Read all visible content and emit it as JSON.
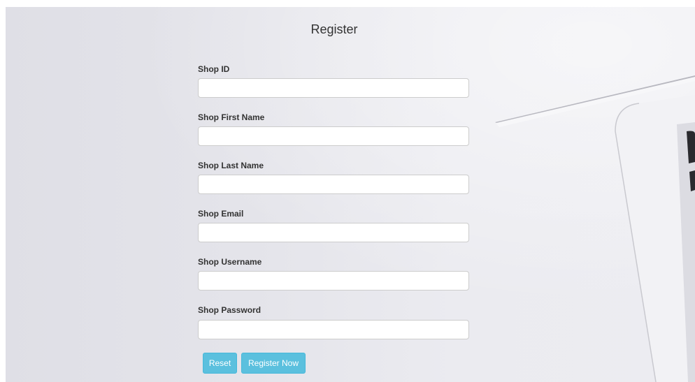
{
  "form": {
    "title": "Register",
    "fields": [
      {
        "label": "Shop ID",
        "value": "",
        "placeholder": ""
      },
      {
        "label": "Shop First Name",
        "value": "",
        "placeholder": ""
      },
      {
        "label": "Shop Last Name",
        "value": "",
        "placeholder": ""
      },
      {
        "label": "Shop Email",
        "value": "",
        "placeholder": ""
      },
      {
        "label": "Shop Username",
        "value": "",
        "placeholder": ""
      },
      {
        "label": "Shop Password",
        "value": "",
        "placeholder": ""
      }
    ],
    "buttons": {
      "reset_label": "Reset",
      "register_label": "Register Now"
    }
  },
  "colors": {
    "button_bg": "#5bc0de",
    "button_border": "#46b8da",
    "background": "#e4e4ea"
  }
}
